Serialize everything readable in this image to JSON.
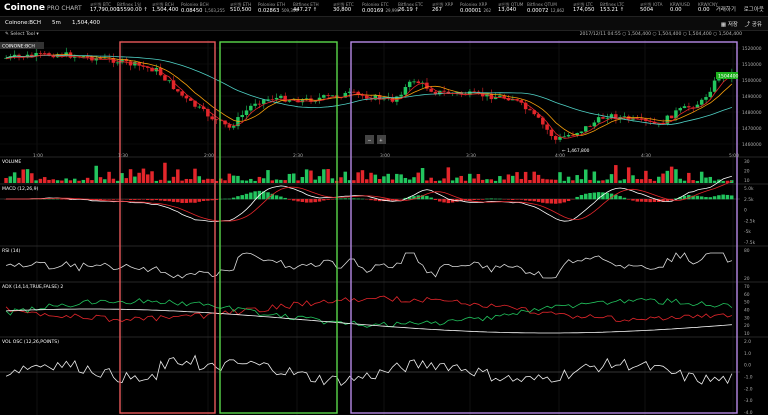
{
  "header": {
    "logo": "Coinone",
    "logo_sub": "PRO CHART",
    "tickers": [
      {
        "label": "코인원 BTC",
        "value": "17,790,000"
      },
      {
        "label": "Bitfinex 1일",
        "value": "15590.00 ↑"
      },
      {
        "label": "코인원 BCH",
        "value": "1,504,400"
      },
      {
        "label": "Poloniex BCH",
        "value": "0.08450",
        "sub": "1,503,255"
      },
      {
        "label": "코인원 ETH",
        "value": "510,500"
      },
      {
        "label": "Poloniex ETH",
        "value": "0.02863",
        "sub": "509,349"
      },
      {
        "label": "Bitfinex ETH",
        "value": "447.27 ↑"
      },
      {
        "label": "코인원 ETC",
        "value": "30,800"
      },
      {
        "label": "Poloniex ETC",
        "value": "0.00169",
        "sub": "29,999"
      },
      {
        "label": "Bitfinex ETC",
        "value": "26.19 ↑"
      },
      {
        "label": "코인원 XRP",
        "value": "267"
      },
      {
        "label": "Poloniex XRP",
        "value": "0.00001",
        "sub": "262"
      },
      {
        "label": "코인원 QTUM",
        "value": "13,040"
      },
      {
        "label": "Bitfinex QTUM",
        "value": "0.00072",
        "sub": "12,862"
      },
      {
        "label": "코인원 LTC",
        "value": "174,050"
      },
      {
        "label": "Bitfinex LTC",
        "value": "153.21 ↑"
      },
      {
        "label": "코인원 IOTA",
        "value": "5004"
      },
      {
        "label": "KRW/USD",
        "value": "0.00"
      },
      {
        "label": "KRW/CNY",
        "value": "0.00"
      }
    ],
    "links": [
      "거래하기",
      "로그아웃"
    ]
  },
  "symbolbar": {
    "symbol": "Coinone:BCH",
    "timeframe": "5m",
    "price": "1,504,400",
    "toolbar_icons": [
      "저장",
      "공유"
    ]
  },
  "toolrow": {
    "select_tool": "Select Tool",
    "ohlc": "2017/12/11 04:55  ○ 1,504,400  ○ 1,504,400  ○ 1,504,400  ○ 1,504,400"
  },
  "chart_data": {
    "type": "candlestick",
    "symbol_label": "COINONE:BCH",
    "time_ticks": [
      "1:00",
      "1:30",
      "2:00",
      "2:30",
      "3:00",
      "3:30",
      "4:00",
      "4:30",
      "5:00"
    ],
    "price_axis": [
      "1520000",
      "1510000",
      "1500000",
      "1490000",
      "1480000",
      "1470000",
      "1460000"
    ],
    "last_price_label": "1504400",
    "low_marker": "← 1,467,800",
    "zoom": {
      "minus": "−",
      "plus": "+"
    },
    "panels": [
      {
        "name": "VOLUME",
        "axis": [
          "30",
          "20",
          "10"
        ]
      },
      {
        "name": "MACD (12,26,9)",
        "axis": [
          "5.0k",
          "2.5k",
          "0",
          "-2.5k",
          "-5k",
          "-7.5k"
        ]
      },
      {
        "name": "RSI (14)",
        "axis": [
          "80",
          "20"
        ]
      },
      {
        "name": "ADX (14,14,TRUE,FALSE) 2",
        "axis": [
          "70",
          "60",
          "50",
          "40",
          "30",
          "20",
          "10"
        ]
      },
      {
        "name": "VOL OSC (12,26,POINTS)",
        "axis": [
          "2.0",
          "1.0",
          "0.0",
          "-1.0",
          "-2.0",
          "-3.0",
          "-4.0"
        ]
      }
    ],
    "highlight_boxes": [
      {
        "color": "#e8585a"
      },
      {
        "color": "#5ad84a"
      },
      {
        "color": "#b68ae6"
      }
    ]
  }
}
